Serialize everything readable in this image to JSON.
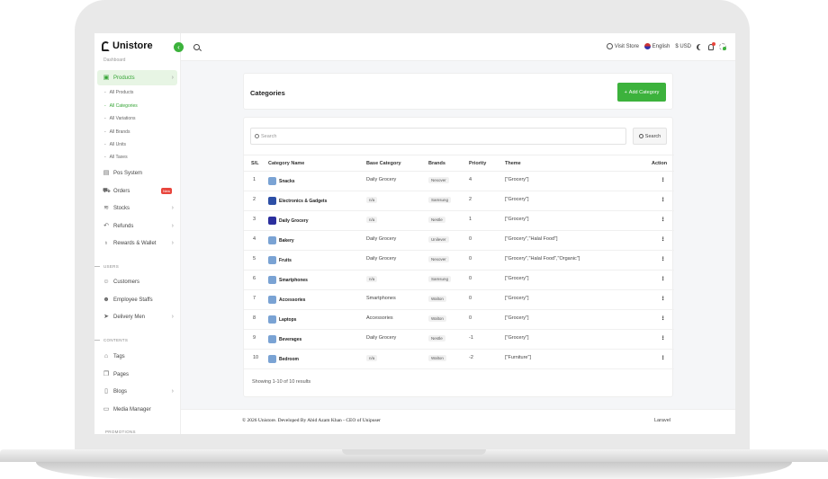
{
  "brand": {
    "name": "Unistore"
  },
  "sidebar": {
    "cut_label": "Dashboard",
    "items": [
      {
        "label": "Products",
        "icon": "box-icon"
      },
      {
        "label": "Pos System",
        "icon": "pos-icon"
      },
      {
        "label": "Orders",
        "icon": "cart-icon",
        "badge": "New"
      },
      {
        "label": "Stocks",
        "icon": "database-icon"
      },
      {
        "label": "Refunds",
        "icon": "undo-icon"
      },
      {
        "label": "Rewards & Wallet",
        "icon": "award-icon"
      },
      {
        "label": "Customers",
        "icon": "user-icon"
      },
      {
        "label": "Employee Staffs",
        "icon": "users-icon"
      },
      {
        "label": "Delivery Men",
        "icon": "send-icon"
      },
      {
        "label": "Tags",
        "icon": "tag-icon"
      },
      {
        "label": "Pages",
        "icon": "pages-icon"
      },
      {
        "label": "Blogs",
        "icon": "file-icon"
      },
      {
        "label": "Media Manager",
        "icon": "folder-icon"
      }
    ],
    "sub_items": [
      "All Products",
      "All Categories",
      "All Variations",
      "All Brands",
      "All Units",
      "All Taxes"
    ],
    "sections": [
      "USERS",
      "CONTENTS",
      "PROMOTIONS"
    ]
  },
  "topbar": {
    "visit_store": "Visit Store",
    "language": "English",
    "currency": "$ USD"
  },
  "page": {
    "title": "Categories",
    "add_button": "Add Category"
  },
  "search": {
    "placeholder": "Search",
    "button": "Search"
  },
  "table": {
    "columns": [
      "S/L",
      "Category Name",
      "Base Category",
      "Brands",
      "Priority",
      "Theme",
      "Action"
    ],
    "rows": [
      {
        "sl": "1",
        "name": "Snacks",
        "base": "Daily Grocery",
        "brand": "Nexover",
        "priority": "4",
        "theme": "[\"Grocery\"]",
        "img": "#7aa3d4"
      },
      {
        "sl": "2",
        "name": "Electronics & Gadgets",
        "base": "n/a",
        "brand": "Samsung",
        "priority": "2",
        "theme": "[\"Grocery\"]",
        "img": "#2d4fa6"
      },
      {
        "sl": "3",
        "name": "Daily Grocery",
        "base": "n/a",
        "brand": "Nestle",
        "priority": "1",
        "theme": "[\"Grocery\"]",
        "img": "#2b2f9e"
      },
      {
        "sl": "4",
        "name": "Bakery",
        "base": "Daily Grocery",
        "brand": "Unilever",
        "priority": "0",
        "theme": "[\"Grocery\",\"Halal Food\"]",
        "img": "#7aa3d4"
      },
      {
        "sl": "5",
        "name": "Fruits",
        "base": "Daily Grocery",
        "brand": "Nexover",
        "priority": "0",
        "theme": "[\"Grocery\",\"Halal Food\",\"Organic\"]",
        "img": "#7aa3d4"
      },
      {
        "sl": "6",
        "name": "Smartphones",
        "base": "n/a",
        "brand": "Samsung",
        "priority": "0",
        "theme": "[\"Grocery\"]",
        "img": "#7aa3d4"
      },
      {
        "sl": "7",
        "name": "Accessories",
        "base": "Smartphones",
        "brand": "Walton",
        "priority": "0",
        "theme": "[\"Grocery\"]",
        "img": "#7aa3d4"
      },
      {
        "sl": "8",
        "name": "Laptops",
        "base": "Accessories",
        "brand": "Walton",
        "priority": "0",
        "theme": "[\"Grocery\"]",
        "img": "#7aa3d4"
      },
      {
        "sl": "9",
        "name": "Beverages",
        "base": "Daily Grocery",
        "brand": "Nestle",
        "priority": "-1",
        "theme": "[\"Grocery\"]",
        "img": "#7aa3d4"
      },
      {
        "sl": "10",
        "name": "Bedroom",
        "base": "n/a",
        "brand": "Walton",
        "priority": "-2",
        "theme": "[\"Furniture\"]",
        "img": "#7aa3d4"
      }
    ]
  },
  "pagination": {
    "info": "Showing 1-10 of 10 results"
  },
  "footer": {
    "copyright": "© 2026 Unistore. Developed By Abid Azam Khan - CEO of Unipuser",
    "right": "Laravel"
  },
  "colors": {
    "accent": "#3cb23c",
    "badge": "#e8453c"
  }
}
